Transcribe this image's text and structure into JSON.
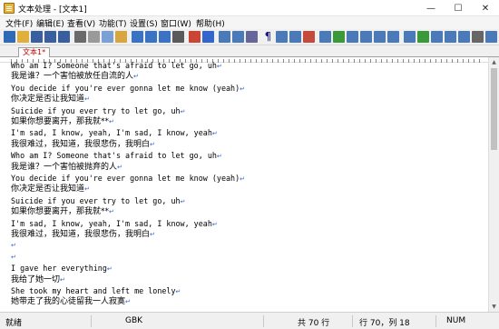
{
  "window": {
    "title": "文本处理 - [文本1]",
    "minimize": "—",
    "maximize": "☐",
    "close": "✕"
  },
  "menu": {
    "items": [
      "文件(F)",
      "编辑(E)",
      "查看(V)",
      "功能(T)",
      "设置(S)",
      "窗口(W)",
      "帮助(H)"
    ]
  },
  "toolbar": {
    "icons": [
      "new-file-icon",
      "open-folder-icon",
      "save-icon",
      "save-all-icon",
      "save-as-icon",
      "print-icon",
      "cut-icon",
      "copy-icon",
      "paste-icon",
      "find-icon",
      "replace-icon",
      "find-next-icon",
      "binoculars-icon",
      "undo-icon",
      "redo-icon",
      "table-icon",
      "tool-icon",
      "format-icon",
      "paragraph-icon",
      "link-icon",
      "highlight-icon",
      "edit-icon",
      "format2-icon",
      "check-icon",
      "text-icon",
      "list-icon",
      "grid-icon",
      "calendar-icon",
      "arrow-icon",
      "export-icon",
      "filter-icon",
      "run-icon",
      "sort-icon",
      "options-icon",
      "help-icon"
    ],
    "colors": [
      "#2e6ab5",
      "#e0b13a",
      "#3a5f9e",
      "#3a5f9e",
      "#3a5f9e",
      "#6a6a6a",
      "#9a9a9a",
      "#7aa0d6",
      "#d8a640",
      "#3b73c4",
      "#3b73c4",
      "#3b73c4",
      "#5a5a5a",
      "#cc4433",
      "#3366cc",
      "#4a7ab8",
      "#4a7ab8",
      "#666699",
      "#1a1a8a",
      "#4a7ab8",
      "#4a7ab8",
      "#c44a3b",
      "#4a7ab8",
      "#3a9a3a",
      "#4a7ab8",
      "#4a7ab8",
      "#4a7ab8",
      "#4a7ab8",
      "#4a7ab8",
      "#3a9a3a",
      "#4a7ab8",
      "#4a7ab8",
      "#4a7ab8",
      "#666666",
      "#4a7ab8"
    ]
  },
  "tabs": [
    {
      "label": "文本1*"
    }
  ],
  "editor": {
    "paragraph_mark": "↵",
    "lines": [
      {
        "text": "Who am I? Someone that's afraid to let go, uh",
        "lang": "en"
      },
      {
        "text": "我是谁？一个害怕被放任自流的人",
        "lang": "cn"
      },
      {
        "text": "You decide if you're ever gonna let me know (yeah)",
        "lang": "en"
      },
      {
        "text": "你决定是否让我知道",
        "lang": "cn"
      },
      {
        "text": "Suicide if you ever try to let go, uh",
        "lang": "en"
      },
      {
        "text": "如果你想要离开，那我就**",
        "lang": "cn"
      },
      {
        "text": "I'm sad, I know, yeah, I'm sad, I know, yeah",
        "lang": "en"
      },
      {
        "text": "我很难过，我知道，我很悲伤，我明白",
        "lang": "cn"
      },
      {
        "text": "Who am I? Someone that's afraid to let go, uh",
        "lang": "en"
      },
      {
        "text": "我是谁？一个害怕被抛弃的人",
        "lang": "cn"
      },
      {
        "text": "You decide if you're ever gonna let me know (yeah)",
        "lang": "en"
      },
      {
        "text": "你决定是否让我知道",
        "lang": "cn"
      },
      {
        "text": "Suicide if you ever try to let go, uh",
        "lang": "en"
      },
      {
        "text": "如果你想要离开，那我就**",
        "lang": "cn"
      },
      {
        "text": "I'm sad, I know, yeah, I'm sad, I know, yeah",
        "lang": "en"
      },
      {
        "text": "我很难过，我知道，我很悲伤，我明白",
        "lang": "cn"
      },
      {
        "text": "",
        "lang": "cn"
      },
      {
        "text": "",
        "lang": "cn"
      },
      {
        "text": "I gave her everything",
        "lang": "en"
      },
      {
        "text": "我给了她一切",
        "lang": "cn"
      },
      {
        "text": "She took my heart and left me lonely",
        "lang": "en"
      },
      {
        "text": "她带走了我的心徒留我一人寂寞",
        "lang": "cn"
      }
    ]
  },
  "status": {
    "ready": "就绪",
    "encoding": "GBK",
    "total_lines": "共 70 行",
    "position": "行 70，列 18",
    "num": "NUM"
  }
}
